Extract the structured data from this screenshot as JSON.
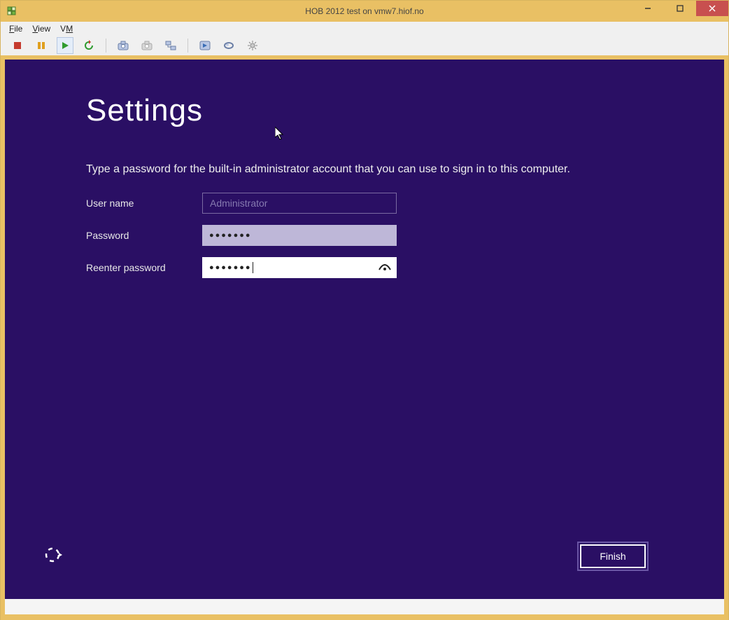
{
  "window": {
    "title": "HOB 2012 test on vmw7.hiof.no"
  },
  "menu": {
    "file": "File",
    "view": "View",
    "vm": "VM"
  },
  "setup": {
    "heading": "Settings",
    "description": "Type a password for the built-in administrator account that you can use to sign in to this computer.",
    "labels": {
      "username": "User name",
      "password": "Password",
      "reenter": "Reenter password"
    },
    "values": {
      "username": "Administrator",
      "password_mask": "●●●●●●●",
      "reenter_mask": "●●●●●●●"
    },
    "finish": "Finish"
  }
}
